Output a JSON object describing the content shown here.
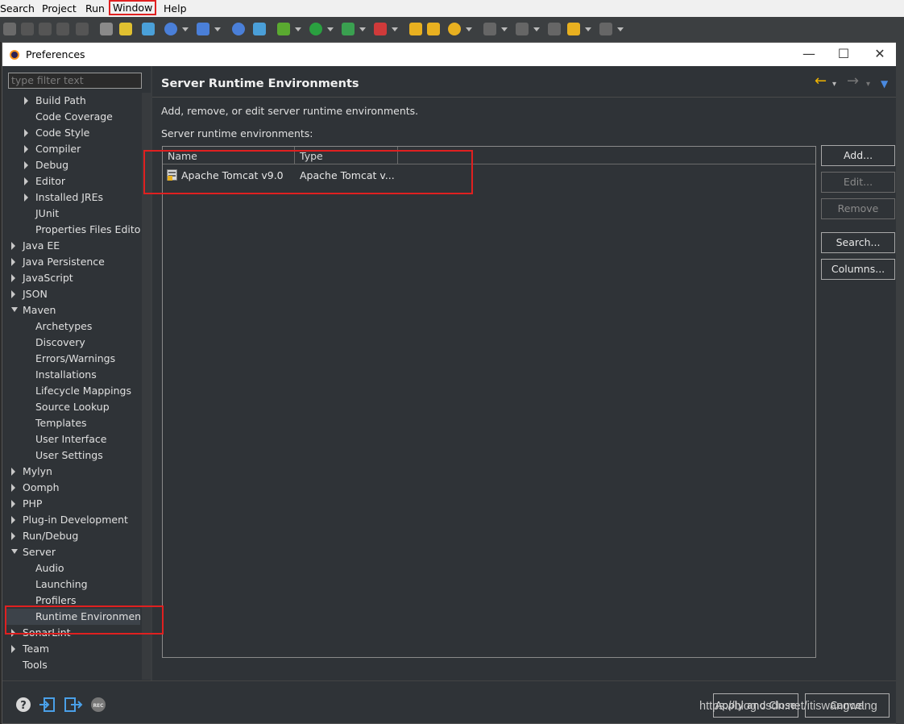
{
  "menubar": {
    "items": [
      "Search",
      "Project",
      "Run",
      "Window",
      "Help"
    ]
  },
  "toolbar": {
    "icons": [
      "save-icon",
      "build-icon",
      "debug-icon",
      "run-icon",
      "new-server-icon",
      "search-icon",
      "back-icon",
      "forward-icon"
    ]
  },
  "dialog": {
    "title": "Preferences",
    "window_controls": {
      "minimize": "—",
      "maximize": "☐",
      "close": "✕"
    }
  },
  "filter": {
    "placeholder": "type filter text"
  },
  "tree": [
    {
      "label": "Build Path",
      "level": 2,
      "expand": "closed"
    },
    {
      "label": "Code Coverage",
      "level": 2,
      "expand": "none"
    },
    {
      "label": "Code Style",
      "level": 2,
      "expand": "closed"
    },
    {
      "label": "Compiler",
      "level": 2,
      "expand": "closed"
    },
    {
      "label": "Debug",
      "level": 2,
      "expand": "closed"
    },
    {
      "label": "Editor",
      "level": 2,
      "expand": "closed"
    },
    {
      "label": "Installed JREs",
      "level": 2,
      "expand": "closed"
    },
    {
      "label": "JUnit",
      "level": 2,
      "expand": "none"
    },
    {
      "label": "Properties Files Edito",
      "level": 2,
      "expand": "none"
    },
    {
      "label": "Java EE",
      "level": 1,
      "expand": "closed"
    },
    {
      "label": "Java Persistence",
      "level": 1,
      "expand": "closed"
    },
    {
      "label": "JavaScript",
      "level": 1,
      "expand": "closed"
    },
    {
      "label": "JSON",
      "level": 1,
      "expand": "closed"
    },
    {
      "label": "Maven",
      "level": 1,
      "expand": "open"
    },
    {
      "label": "Archetypes",
      "level": 2,
      "expand": "none"
    },
    {
      "label": "Discovery",
      "level": 2,
      "expand": "none"
    },
    {
      "label": "Errors/Warnings",
      "level": 2,
      "expand": "none"
    },
    {
      "label": "Installations",
      "level": 2,
      "expand": "none"
    },
    {
      "label": "Lifecycle Mappings",
      "level": 2,
      "expand": "none"
    },
    {
      "label": "Source Lookup",
      "level": 2,
      "expand": "none"
    },
    {
      "label": "Templates",
      "level": 2,
      "expand": "none"
    },
    {
      "label": "User Interface",
      "level": 2,
      "expand": "none"
    },
    {
      "label": "User Settings",
      "level": 2,
      "expand": "none"
    },
    {
      "label": "Mylyn",
      "level": 1,
      "expand": "closed"
    },
    {
      "label": "Oomph",
      "level": 1,
      "expand": "closed"
    },
    {
      "label": "PHP",
      "level": 1,
      "expand": "closed"
    },
    {
      "label": "Plug-in Development",
      "level": 1,
      "expand": "closed"
    },
    {
      "label": "Run/Debug",
      "level": 1,
      "expand": "closed"
    },
    {
      "label": "Server",
      "level": 1,
      "expand": "open"
    },
    {
      "label": "Audio",
      "level": 2,
      "expand": "none"
    },
    {
      "label": "Launching",
      "level": 2,
      "expand": "none"
    },
    {
      "label": "Profilers",
      "level": 2,
      "expand": "none"
    },
    {
      "label": "Runtime Environment",
      "level": 2,
      "expand": "none",
      "selected": true
    },
    {
      "label": "SonarLint",
      "level": 1,
      "expand": "closed"
    },
    {
      "label": "Team",
      "level": 1,
      "expand": "closed"
    },
    {
      "label": "Tools",
      "level": 1,
      "expand": "none"
    }
  ],
  "page": {
    "title": "Server Runtime Environments",
    "description": "Add, remove, or edit server runtime environments.",
    "list_label": "Server runtime environments:",
    "columns": [
      "Name",
      "Type"
    ],
    "rows": [
      {
        "name": "Apache Tomcat v9.0",
        "type": "Apache Tomcat v..."
      }
    ],
    "buttons": {
      "add": "Add...",
      "edit": "Edit...",
      "remove": "Remove",
      "search": "Search...",
      "columns": "Columns..."
    }
  },
  "footer": {
    "apply_close": "Apply and Close",
    "cancel": "Cancel",
    "icons": [
      "help-icon",
      "import-icon",
      "export-icon",
      "record-icon"
    ]
  },
  "watermark": "https://blog.csdn.net/itiswangwang",
  "colors": {
    "highlight_box": "#e02020",
    "background": "#2f3337",
    "nav_arrow": "#f0b400"
  }
}
